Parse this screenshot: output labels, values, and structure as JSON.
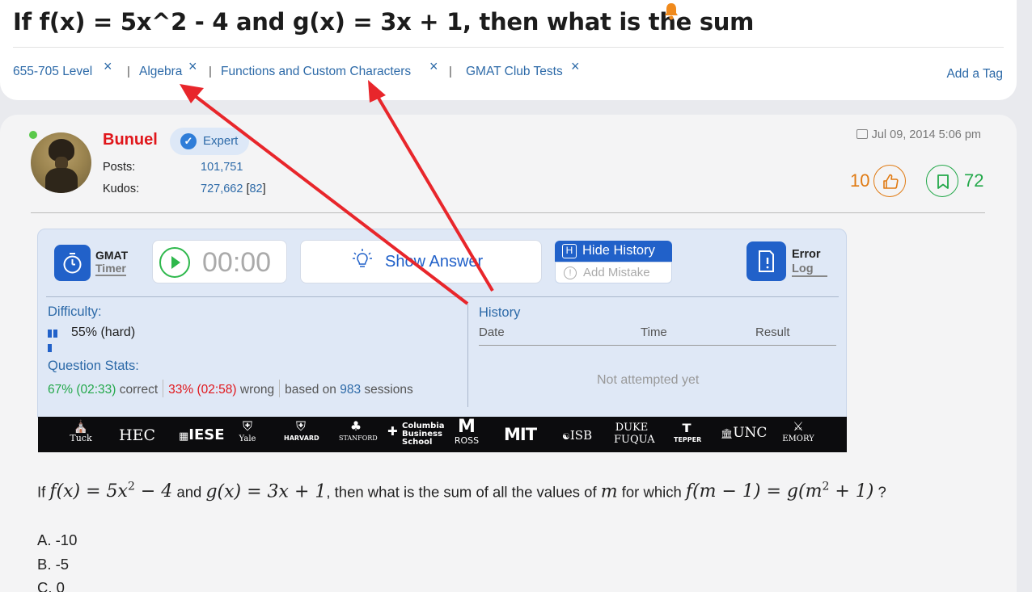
{
  "question_title": "If f(x) = 5x^2 - 4 and g(x) = 3x + 1, then what is the sum",
  "tags": [
    {
      "label": "655-705 Level"
    },
    {
      "label": "Algebra"
    },
    {
      "label": "Functions and Custom Characters"
    },
    {
      "label": "GMAT Club Tests"
    }
  ],
  "tag_remove_glyph": "×",
  "tag_separator": "|",
  "add_tag_label": "Add a Tag",
  "post": {
    "username": "Bunuel",
    "badge": "Expert",
    "posts_label": "Posts:",
    "posts_value": "101,751",
    "kudos_label": "Kudos:",
    "kudos_value": "727,662",
    "kudos_bracket_open": "[",
    "kudos_extra": "82",
    "kudos_bracket_close": "]",
    "date": "Jul 09, 2014 5:06 pm",
    "kudos_count": "10",
    "bookmark_count": "72"
  },
  "timer_panel": {
    "gmat_label": "GMAT",
    "timer_label": "Timer",
    "time": "00:00",
    "show_answer": "Show Answer",
    "hide_history_key": "H",
    "hide_history": "Hide History",
    "add_mistake_icon": "!",
    "add_mistake": "Add Mistake",
    "error_label": "Error",
    "log_label": "Log",
    "difficulty_title": "Difficulty:",
    "difficulty_value": "55% (hard)",
    "stats_title": "Question Stats:",
    "correct_pct": "67% (02:33)",
    "correct_word": "correct",
    "wrong_pct": "33% (02:58)",
    "wrong_word": "wrong",
    "based_on": "based on",
    "sessions_count": "983",
    "sessions_word": "sessions",
    "history_title": "History",
    "history_columns": [
      "Date",
      "Time",
      "Result"
    ],
    "history_empty": "Not attempted yet"
  },
  "school_logos": [
    "Tuck",
    "HEC",
    "IESE",
    "Yale",
    "HARVARD",
    "STANFORD",
    "Columbia Business School",
    "ROSS",
    "MIT",
    "ISB",
    "DUKE FUQUA",
    "TEPPER",
    "UNC",
    "EMORY"
  ],
  "question": {
    "p1": "If",
    "f_def": "f(x) = 5x",
    "f_exp": "2",
    "f_rest": " − 4",
    "and": "and",
    "g_def": "g(x) = 3x + 1",
    "p2": ", then what is the sum of all the values of",
    "var_m": "m",
    "p3": "for which",
    "eq_left": "f(m − 1) = g(m",
    "eq_exp": "2",
    "eq_right": " + 1)",
    "p4": "?"
  },
  "choices": [
    "A. -10",
    "B. -5",
    "C. 0"
  ],
  "colors": {
    "link": "#2d6aa8",
    "username": "#e0161b",
    "kudos": "#e07a12",
    "bookmark": "#23a84a",
    "primary": "#2161c9",
    "arrow": "#e8262b"
  },
  "icons": [
    "bell-icon",
    "check-icon",
    "comment-icon",
    "thumbs-up-icon",
    "bookmark-icon",
    "stopwatch-icon",
    "play-icon",
    "bulb-icon",
    "error-log-icon"
  ]
}
